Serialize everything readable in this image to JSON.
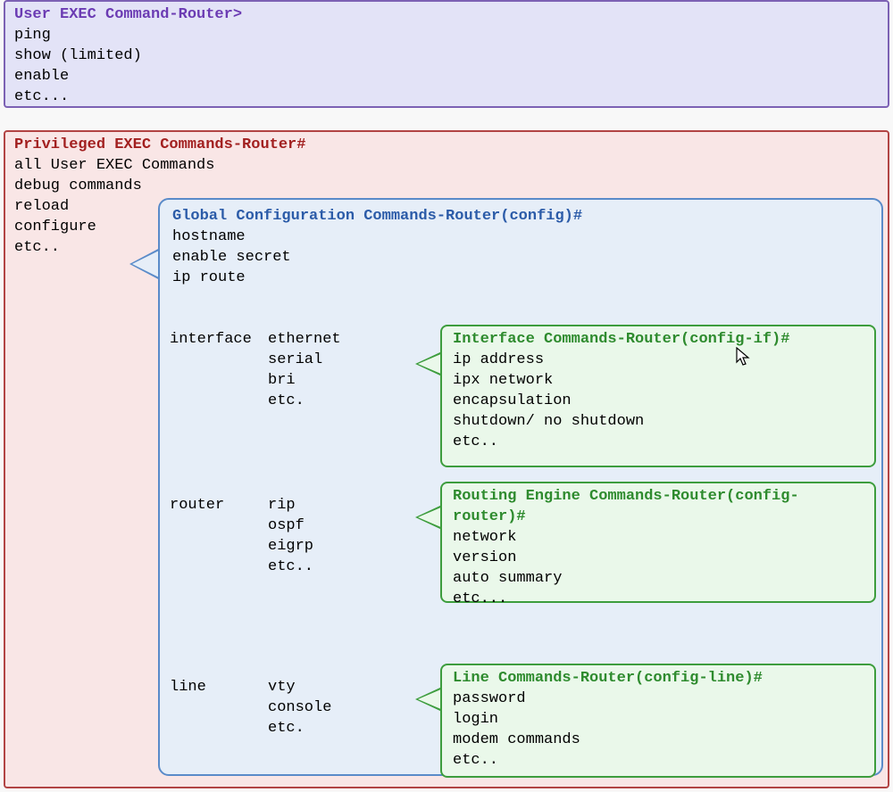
{
  "user_exec": {
    "title": "User EXEC Command-Router>",
    "lines": [
      "ping",
      "show (limited)",
      "enable",
      "etc..."
    ]
  },
  "priv_exec": {
    "title": "Privileged EXEC Commands-Router#",
    "lines": [
      "all User EXEC Commands",
      "debug commands",
      "reload",
      "configure",
      "etc.."
    ]
  },
  "global_cfg": {
    "title": "Global Configuration Commands-Router(config)#",
    "header_lines": [
      "hostname",
      "enable secret",
      "ip route"
    ],
    "groups": {
      "interface": {
        "key": "interface",
        "values": [
          "ethernet",
          "serial",
          "bri",
          "etc."
        ]
      },
      "router": {
        "key": "router",
        "values": [
          "rip",
          "ospf",
          "eigrp",
          "etc.."
        ]
      },
      "line": {
        "key": "line",
        "values": [
          "vty",
          "console",
          "etc."
        ]
      }
    }
  },
  "interface_box": {
    "title": "Interface Commands-Router(config-if)#",
    "lines": [
      "ip address",
      "ipx network",
      "encapsulation",
      "shutdown/ no shutdown",
      "etc.."
    ]
  },
  "router_box": {
    "title": "Routing Engine Commands-Router(config-router)#",
    "lines": [
      "network",
      "version",
      "auto summary",
      "etc..."
    ]
  },
  "line_box": {
    "title": "Line Commands-Router(config-line)#",
    "lines": [
      "password",
      "login",
      "modem commands",
      "etc.."
    ]
  }
}
